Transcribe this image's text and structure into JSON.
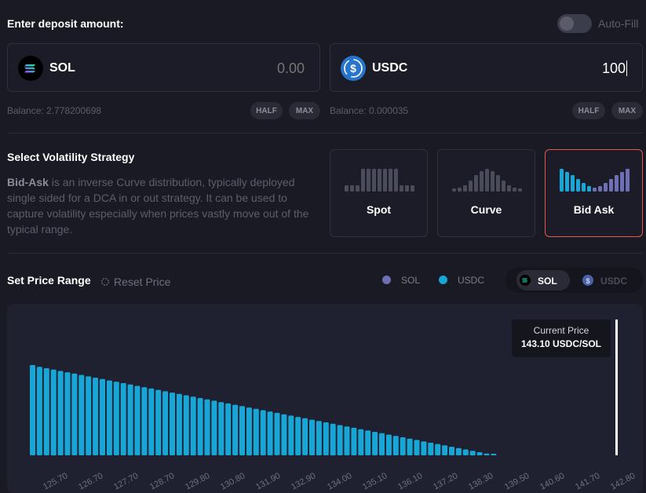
{
  "deposit": {
    "title": "Enter deposit amount:",
    "autofill_label": "Auto-Fill",
    "token_a": {
      "name": "SOL",
      "amount_placeholder": "0.00",
      "balance": "Balance: 2.778200698",
      "icon": "solana-logo-icon"
    },
    "token_b": {
      "name": "USDC",
      "amount_value": "100",
      "balance": "Balance: 0.000035",
      "icon": "usdc-logo-icon"
    },
    "half_label": "HALF",
    "max_label": "MAX"
  },
  "strategy": {
    "title": "Select Volatility Strategy",
    "desc_bold": "Bid-Ask",
    "desc_rest": " is an inverse Curve distribution, typically deployed single sided for a DCA in or out strategy. It can be used to capture volatility especially when prices vastly move out of the typical range.",
    "options": [
      {
        "label": "Spot",
        "selected": false
      },
      {
        "label": "Curve",
        "selected": false
      },
      {
        "label": "Bid Ask",
        "selected": true
      }
    ]
  },
  "price_range": {
    "title": "Set Price Range",
    "reset_label": "Reset Price",
    "legend": [
      {
        "name": "SOL",
        "color": "#6f6fb5"
      },
      {
        "name": "USDC",
        "color": "#17a6d5"
      }
    ],
    "segment": {
      "options": [
        "SOL",
        "USDC"
      ],
      "active": "SOL"
    },
    "tooltip": {
      "label": "Current Price",
      "value": "143.10 USDC/SOL"
    }
  },
  "chart_data": {
    "type": "bar",
    "bar_color": "#17a6d5",
    "current_price": 143.1,
    "tick_labels": [
      "125.70",
      "126.70",
      "127.70",
      "128.70",
      "129.80",
      "130.80",
      "131.90",
      "132.90",
      "134.00",
      "135.10",
      "136.10",
      "137.20",
      "138.30",
      "139.50",
      "140.60",
      "141.70",
      "142.80"
    ],
    "values": [
      1.0,
      0.98,
      0.965,
      0.95,
      0.935,
      0.92,
      0.905,
      0.89,
      0.875,
      0.86,
      0.845,
      0.83,
      0.815,
      0.8,
      0.785,
      0.77,
      0.755,
      0.74,
      0.725,
      0.71,
      0.695,
      0.68,
      0.665,
      0.65,
      0.635,
      0.62,
      0.605,
      0.59,
      0.575,
      0.56,
      0.545,
      0.53,
      0.515,
      0.5,
      0.485,
      0.47,
      0.455,
      0.44,
      0.425,
      0.41,
      0.395,
      0.38,
      0.365,
      0.35,
      0.335,
      0.32,
      0.305,
      0.29,
      0.275,
      0.26,
      0.245,
      0.23,
      0.215,
      0.2,
      0.185,
      0.17,
      0.155,
      0.14,
      0.125,
      0.11,
      0.095,
      0.08,
      0.065,
      0.05,
      0.035,
      0.02,
      0.01
    ]
  }
}
